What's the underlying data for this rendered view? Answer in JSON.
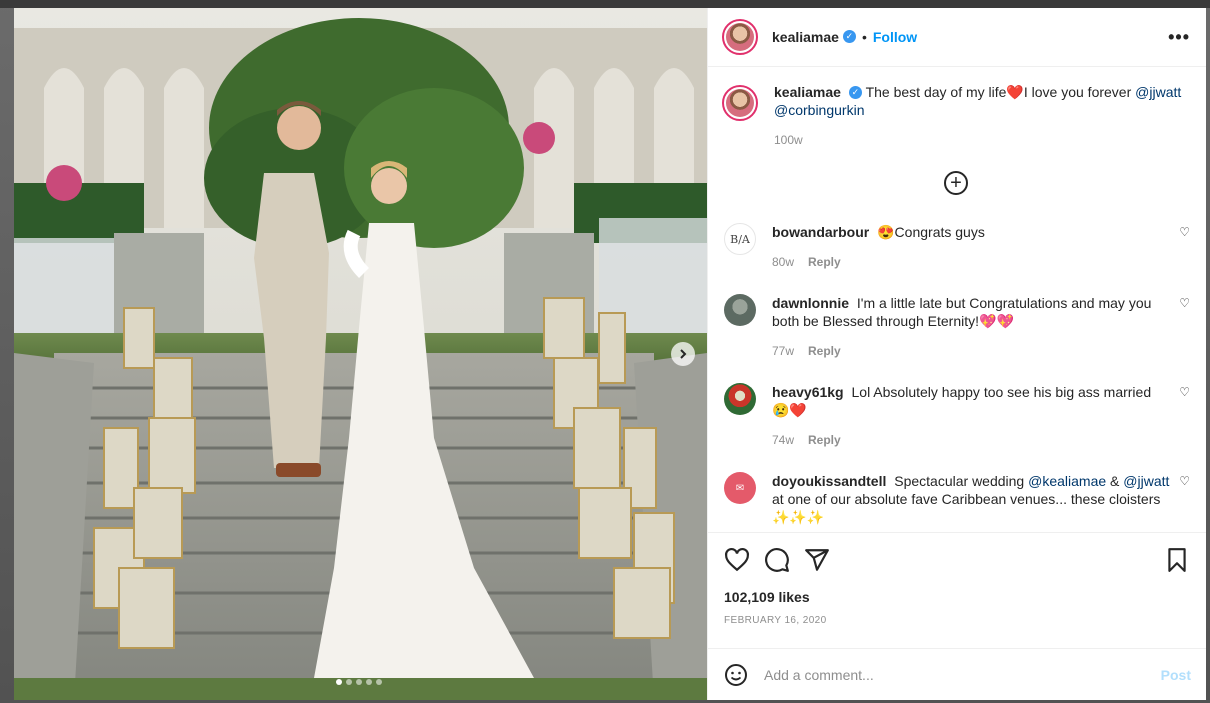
{
  "post": {
    "username": "kealiamae",
    "follow_label": "Follow",
    "separator": "•",
    "more_label": "•••",
    "caption": {
      "username": "kealiamae",
      "text": "The best day of my life❤️I love you forever",
      "mention_1": "@jjwatt",
      "mention_2": "@corbingurkin",
      "time": "100w"
    },
    "comments": [
      {
        "username": "bowandarbour",
        "text": "😍Congrats guys",
        "time": "80w",
        "reply": "Reply",
        "avatar_text": "B/A"
      },
      {
        "username": "dawnlonnie",
        "text": "I'm a little late but Congratulations and may you both be Blessed through Eternity!💖💖",
        "time": "77w",
        "reply": "Reply"
      },
      {
        "username": "heavy61kg",
        "text": "Lol Absolutely happy too see his big ass married 😢❤️",
        "time": "74w",
        "reply": "Reply"
      },
      {
        "username": "doyoukissandtell",
        "text_a": "Spectacular wedding",
        "mention_a": "@kealiamae",
        "text_b": "&",
        "mention_b": "@jjwatt",
        "text_c": "at one of our absolute fave Caribbean venues... these cloisters ✨✨✨",
        "time": "",
        "reply": ""
      }
    ],
    "likes": "102,109 likes",
    "date": "FEBRUARY 16, 2020",
    "add_comment_placeholder": "Add a comment...",
    "post_button": "Post"
  },
  "colors": {
    "link_blue": "#0095f6",
    "mention_blue": "#00376b",
    "verified_blue": "#3897f0",
    "muted_text": "#8e8e8e"
  },
  "icons": [
    "heart-icon",
    "comment-icon",
    "share-icon",
    "bookmark-icon",
    "emoji-icon",
    "more-icon",
    "verified-icon",
    "add-icon",
    "chevron-right-icon"
  ],
  "carousel": {
    "count": 5,
    "active": 0
  }
}
